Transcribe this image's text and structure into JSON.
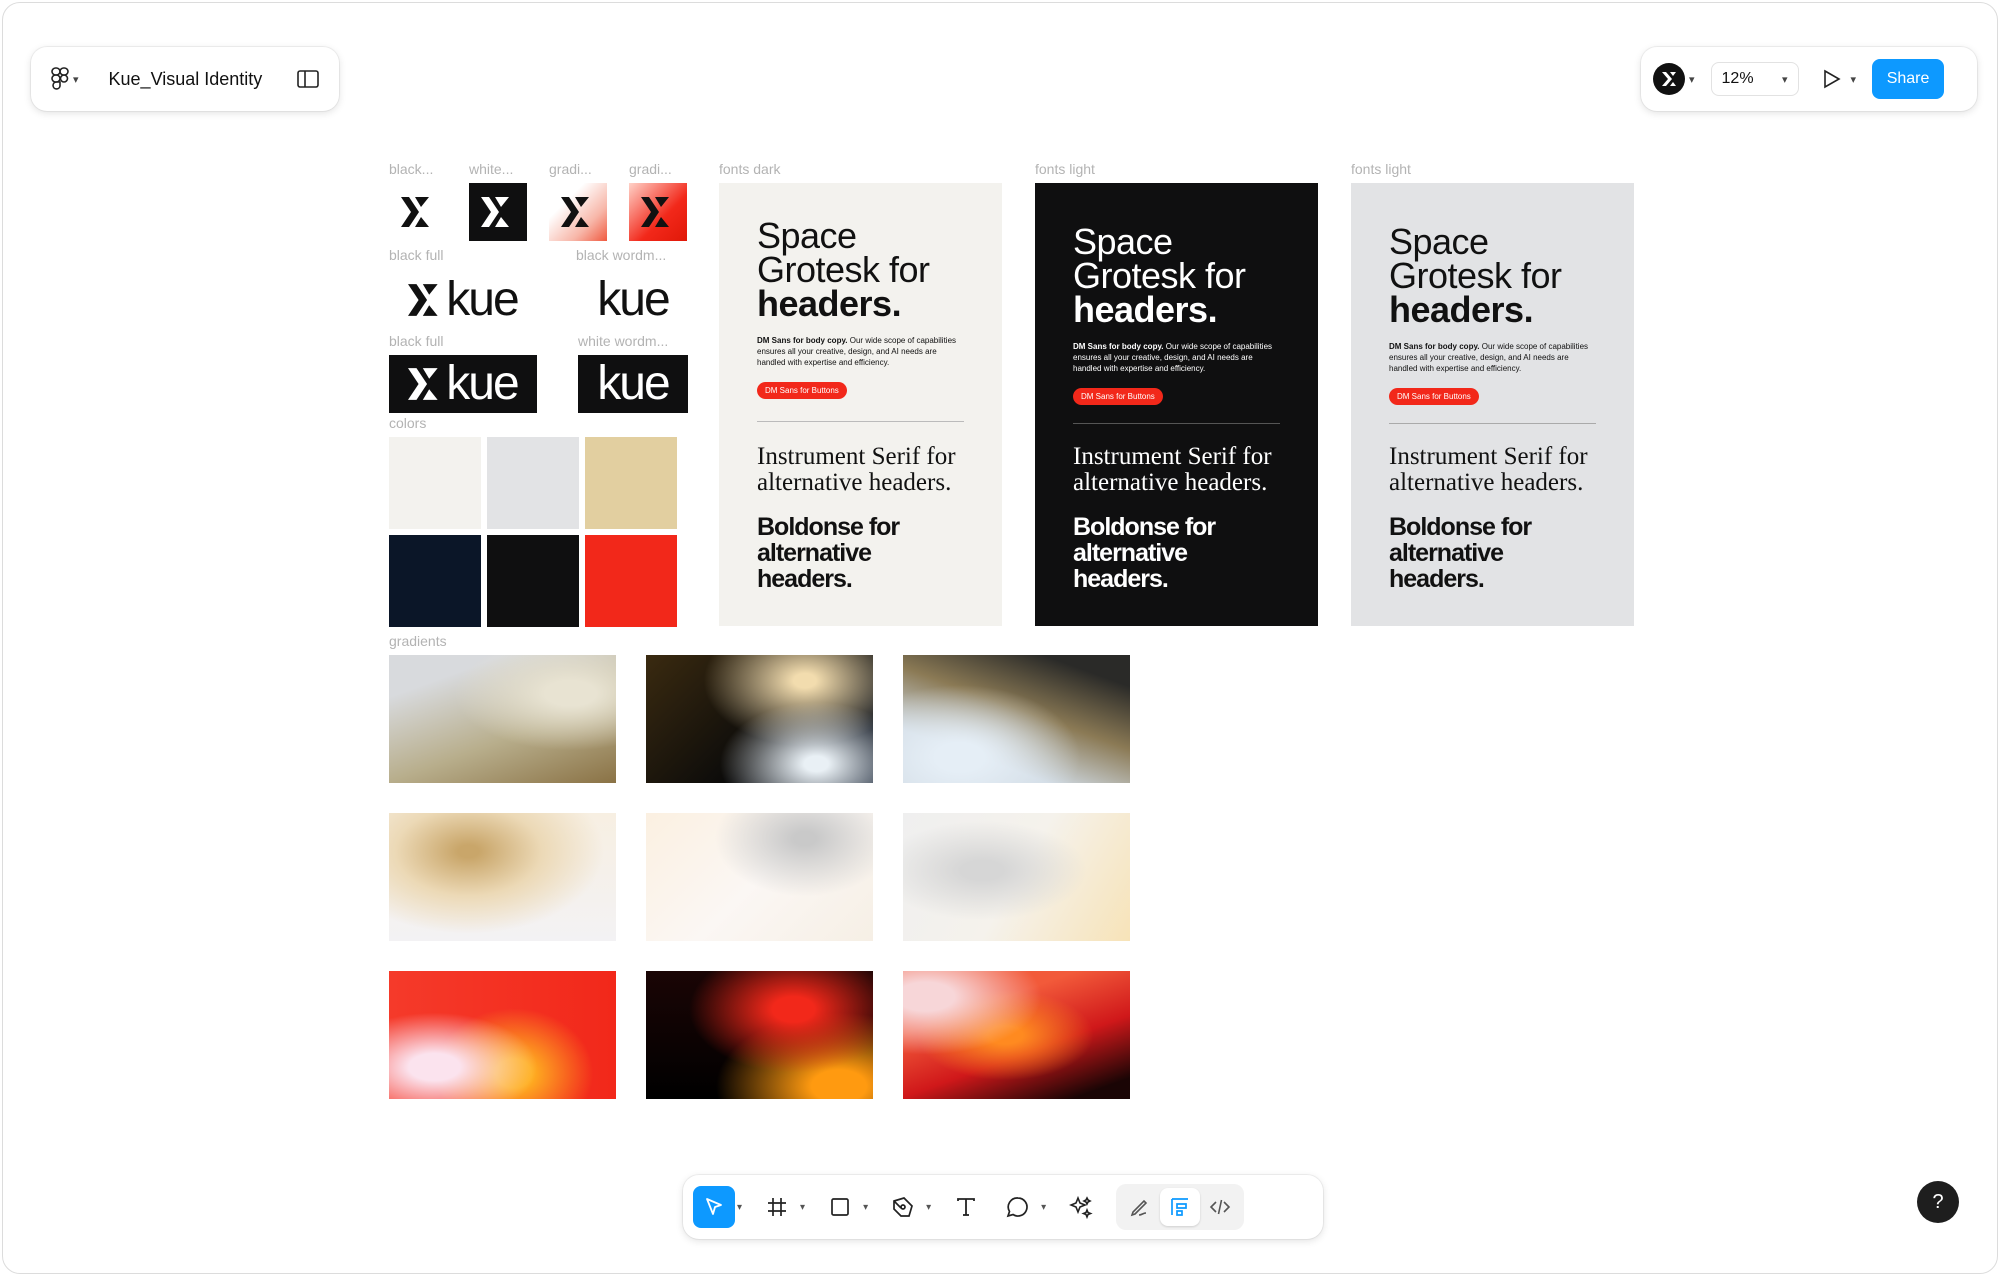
{
  "header": {
    "file_title": "Kue_Visual Identity",
    "zoom": "12%",
    "share_label": "Share"
  },
  "canvas": {
    "logo_labels": [
      "black...",
      "white...",
      "gradi...",
      "gradi..."
    ],
    "black_full_label": "black full",
    "black_wordmark_label": "black wordm...",
    "black_full_label_2": "black full",
    "white_wordmark_label": "white wordm...",
    "wordmark": "kue",
    "colors_label": "colors",
    "gradients_label": "gradients",
    "colors": [
      "#f3f2ee",
      "#e2e3e5",
      "#e2cfa0",
      "#0b1628",
      "#0f0f10",
      "#f2281a"
    ],
    "poster_labels": [
      "fonts dark",
      "fonts light",
      "fonts light"
    ],
    "poster": {
      "headline_1": "Space",
      "headline_2": "Grotesk for",
      "headline_3": "headers.",
      "body_lead": "DM Sans for body copy.",
      "body_rest": " Our wide scope of capabilities ensures all your creative, design, and AI needs are handled with expertise and efficiency.",
      "button": "DM Sans for Buttons",
      "serif_1": "Instrument Serif for",
      "serif_2": "alternative headers.",
      "bold_1": "Boldonse for",
      "bold_2": "alternative headers."
    }
  },
  "toolbar": {
    "tools": [
      "move-tool",
      "frame-tool",
      "rectangle-tool",
      "pen-tool",
      "text-tool",
      "comment-tool",
      "actions-tool"
    ],
    "modes": [
      "draw-mode",
      "design-mode",
      "dev-mode"
    ]
  },
  "help_label": "?"
}
